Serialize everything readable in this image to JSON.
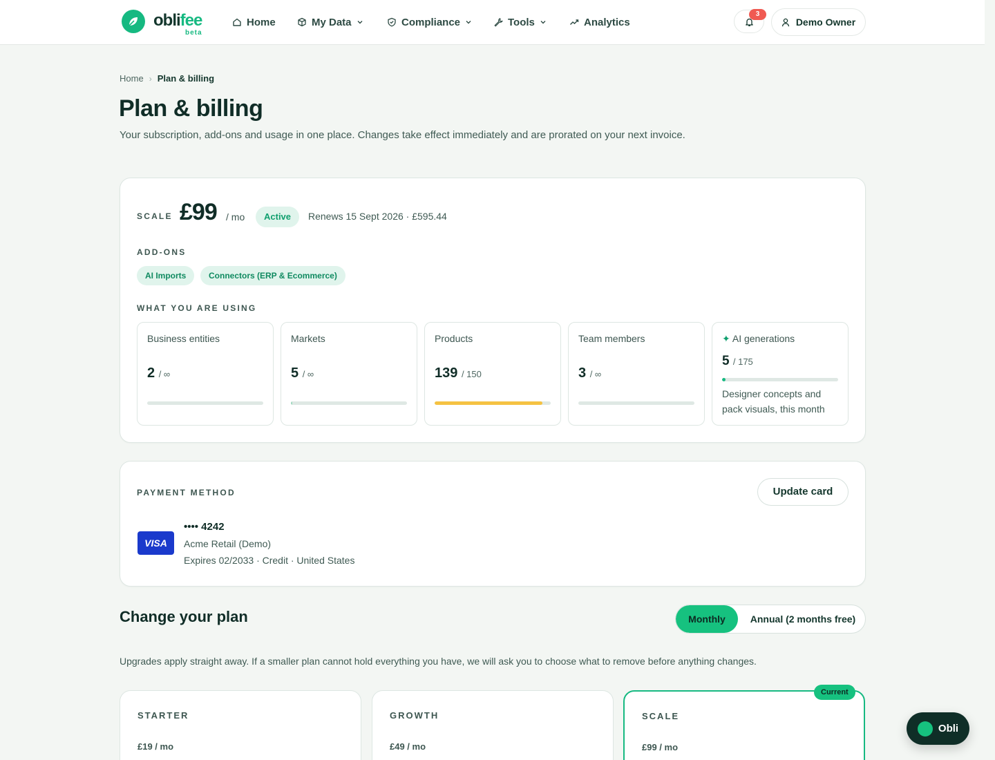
{
  "brand": {
    "name_main": "obli",
    "name_accent": "fee",
    "beta": "beta",
    "accent_color": "#16b981"
  },
  "nav": {
    "items": [
      {
        "label": "Home",
        "icon": "home-icon",
        "has_dropdown": false
      },
      {
        "label": "My Data",
        "icon": "cube-icon",
        "has_dropdown": true
      },
      {
        "label": "Compliance",
        "icon": "shield-icon",
        "has_dropdown": true
      },
      {
        "label": "Tools",
        "icon": "wrench-icon",
        "has_dropdown": true
      },
      {
        "label": "Analytics",
        "icon": "trend-icon",
        "has_dropdown": false
      }
    ],
    "notifications_count": "3",
    "user_label": "Demo Owner"
  },
  "breadcrumb": {
    "home": "Home",
    "current": "Plan & billing"
  },
  "page": {
    "title": "Plan & billing",
    "subtitle": "Your subscription, add-ons and usage in one place. Changes take effect immediately and are prorated on your next invoice."
  },
  "subscription": {
    "plan_name": "SCALE",
    "price": "£99",
    "unit": "/ mo",
    "status": "Active",
    "renews": "Renews 15 Sept 2026 · £595.44",
    "addons_label": "ADD-ONS",
    "addons": [
      "AI Imports",
      "Connectors (ERP & Ecommerce)"
    ],
    "usage_label": "WHAT YOU ARE USING",
    "usage": [
      {
        "title": "Business entities",
        "value": "2",
        "limit": "/ ∞",
        "fraction": 0.0,
        "color": "#dfe8e4"
      },
      {
        "title": "Markets",
        "value": "5",
        "limit": "/ ∞",
        "fraction": 0.01,
        "color": "#9fd9c0"
      },
      {
        "title": "Products",
        "value": "139",
        "limit": "/ 150",
        "fraction": 0.927,
        "color": "#f5c242"
      },
      {
        "title": "Team members",
        "value": "3",
        "limit": "/ ∞",
        "fraction": 0.0,
        "color": "#dfe8e4"
      }
    ],
    "ai": {
      "spark": "✦",
      "title": "AI generations",
      "value": "5",
      "limit": "/ 175",
      "fraction": 0.029,
      "color": "#16b981",
      "note": "Designer concepts and pack visuals, this month"
    }
  },
  "payment": {
    "label": "PAYMENT METHOD",
    "update_button": "Update card",
    "brand": "VISA",
    "number": "•••• 4242",
    "holder": "Acme Retail (Demo)",
    "details": "Expires 02/2033 · Credit · United States"
  },
  "change_plan": {
    "title": "Change your plan",
    "toggle": {
      "monthly": "Monthly",
      "annual": "Annual (2 months free)",
      "selected": "monthly"
    },
    "subtitle": "Upgrades apply straight away. If a smaller plan cannot hold everything you have, we will ask you to choose what to remove before anything changes.",
    "current_badge": "Current",
    "plans": [
      {
        "name": "STARTER",
        "price": "£19 / mo",
        "current": false
      },
      {
        "name": "GROWTH",
        "price": "£49 / mo",
        "current": false
      },
      {
        "name": "SCALE",
        "price": "£99 / mo",
        "current": true
      }
    ]
  },
  "assistant": {
    "label": "Obli"
  }
}
